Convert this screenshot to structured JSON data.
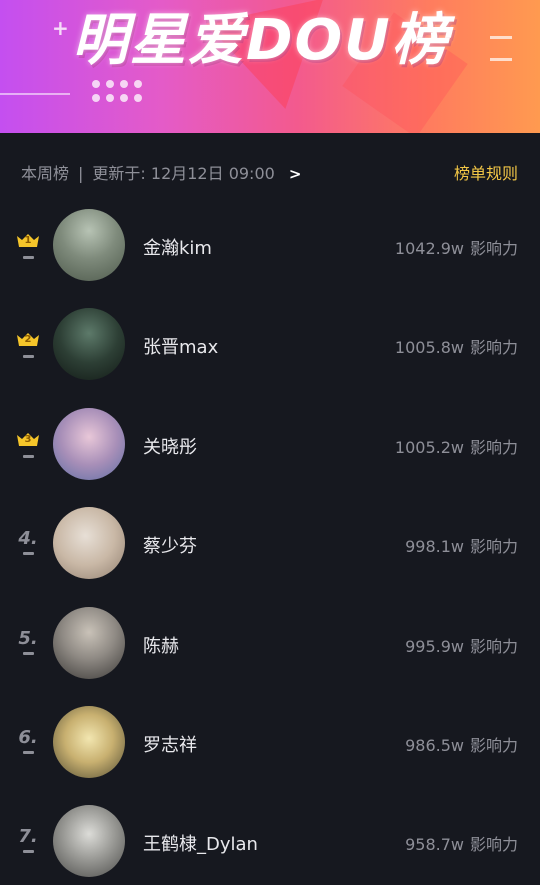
{
  "banner": {
    "title": "明星爱DOU榜"
  },
  "subheader": {
    "period": "本周榜",
    "separator": "|",
    "updated": "更新于: 12月12日 09:00",
    "arrow": ">",
    "rules_link": "榜单规则"
  },
  "colors": {
    "accent": "#f2c646",
    "background": "#16181f",
    "muted": "#8e8f98"
  },
  "score_label": "影响力",
  "rows": [
    {
      "rank": "1",
      "name": "金瀚kim",
      "score": "1042.9w",
      "icon": "crown-icon"
    },
    {
      "rank": "2",
      "name": "张晋max",
      "score": "1005.8w",
      "icon": "crown-icon"
    },
    {
      "rank": "3",
      "name": "关晓彤",
      "score": "1005.2w",
      "icon": "crown-icon"
    },
    {
      "rank": "4.",
      "name": "蔡少芬",
      "score": "998.1w"
    },
    {
      "rank": "5.",
      "name": "陈赫",
      "score": "995.9w"
    },
    {
      "rank": "6.",
      "name": "罗志祥",
      "score": "986.5w"
    },
    {
      "rank": "7.",
      "name": "王鹤棣_Dylan",
      "score": "958.7w"
    }
  ]
}
